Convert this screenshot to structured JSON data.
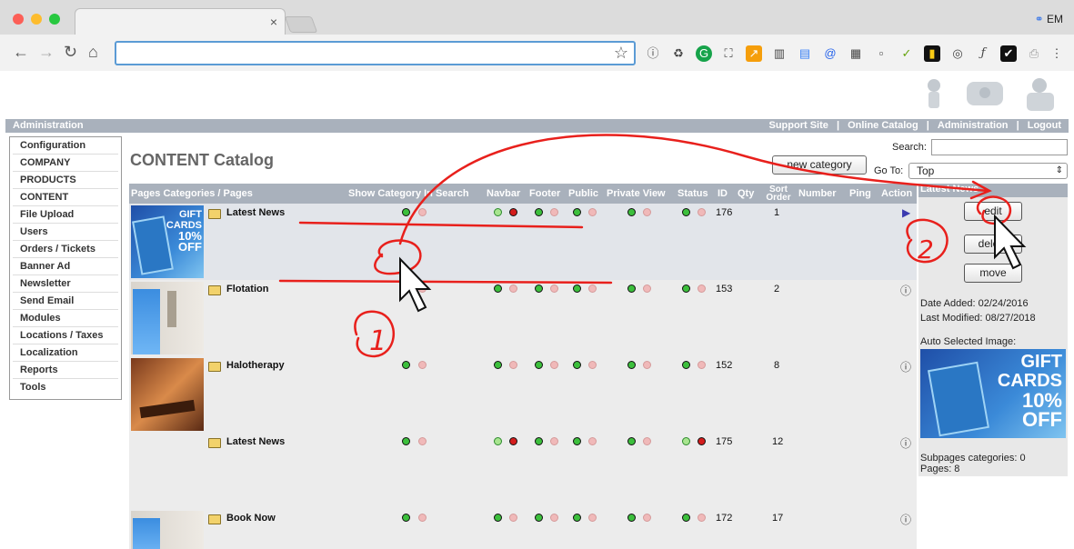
{
  "browser": {
    "profile": "EM",
    "tab_close": "×"
  },
  "topbar": {
    "section": "Administration",
    "links": [
      "Support Site",
      "|",
      "Online Catalog",
      "|",
      "Administration",
      "|",
      "Logout"
    ]
  },
  "sidebar": {
    "items": [
      "Configuration",
      "COMPANY",
      "PRODUCTS",
      "CONTENT",
      "File Upload",
      "Users",
      "Orders / Tickets",
      "Banner Ad",
      "Newsletter",
      "Send Email",
      "Modules",
      "Locations / Taxes",
      "Localization",
      "Reports",
      "Tools"
    ]
  },
  "main": {
    "title": "CONTENT Catalog",
    "new_category": "new category",
    "search_label": "Search:",
    "goto_label": "Go To:",
    "goto_value": "Top"
  },
  "table": {
    "headers": {
      "name": "Pages Categories / Pages",
      "show": "Show Category In Search",
      "navbar": "Navbar",
      "footer": "Footer",
      "public": "Public",
      "private": "Private View",
      "status": "Status",
      "id": "ID",
      "qty": "Qty",
      "sort": "Sort Order",
      "number": "Number",
      "ping": "Ping",
      "action": "Action"
    },
    "rows": [
      {
        "name": "Latest News",
        "id": "176",
        "sort": "1"
      },
      {
        "name": "Flotation",
        "id": "153",
        "sort": "2"
      },
      {
        "name": "Halotherapy",
        "id": "152",
        "sort": "8"
      },
      {
        "name": "Latest News",
        "id": "175",
        "sort": "12"
      },
      {
        "name": "Book Now",
        "id": "172",
        "sort": "17"
      }
    ],
    "thumb_text": {
      "l1": "GIFT",
      "l2": "CARDS",
      "l3": "10%",
      "l4": "OFF"
    }
  },
  "right_panel": {
    "header": "Latest News",
    "edit": "edit",
    "delete": "delete",
    "move": "move",
    "date_added": "Date Added: 02/24/2016",
    "last_modified": "Last Modified: 08/27/2018",
    "auto_image_label": "Auto Selected Image:",
    "subpages": "Subpages categories: 0",
    "pages": "Pages: 8"
  },
  "annotations": {
    "step1": "1",
    "step2": "2"
  },
  "colors": {
    "header_bar": "#a9b1bc",
    "table_bg": "#ececec",
    "annotation_red": "#e8201c"
  }
}
